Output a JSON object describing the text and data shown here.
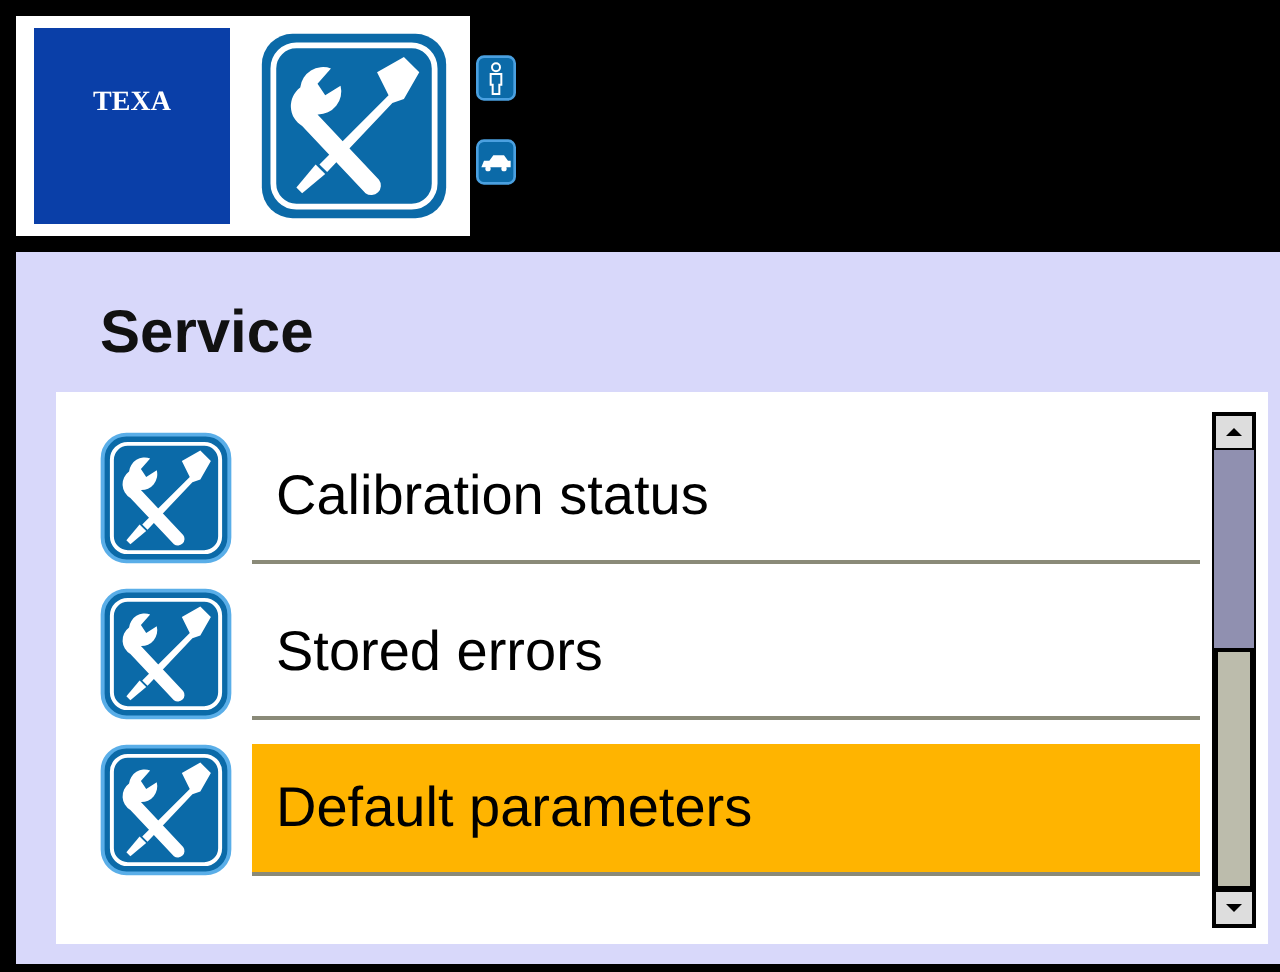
{
  "header": {
    "logo": "TEXA"
  },
  "title": "Service",
  "menu": [
    {
      "label": "Calibration status",
      "selected": false
    },
    {
      "label": "Stored errors",
      "selected": false
    },
    {
      "label": "Default parameters",
      "selected": true
    }
  ]
}
